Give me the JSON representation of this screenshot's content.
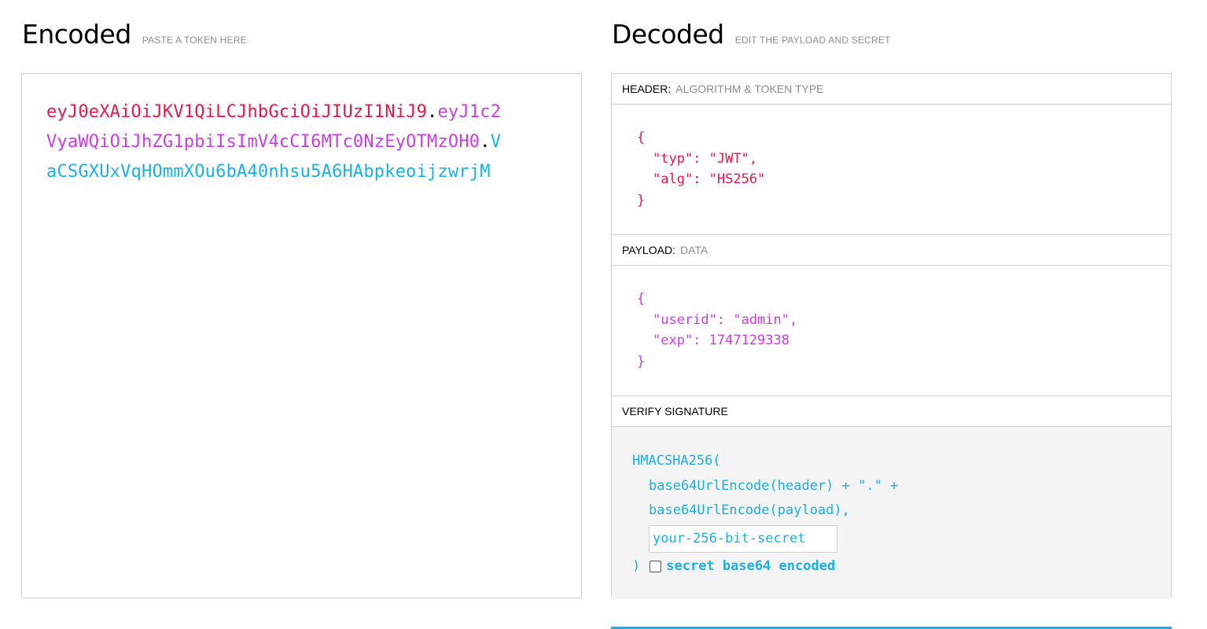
{
  "encoded": {
    "title": "Encoded",
    "hint": "PASTE A TOKEN HERE",
    "token_header": "eyJ0eXAiOiJKV1QiLCJhbGciOiJIUzI1NiJ9",
    "token_payload": "eyJ1c2VyaWQiOiJhZG1pbiIsImV4cCI6MTc0NzEyOTMzOH0",
    "token_signature": "VaCSGXUxVqHOmmXOu6bA40nhsu5A6HAbpkeoijzwrjM",
    "dot": "."
  },
  "decoded": {
    "title": "Decoded",
    "hint": "EDIT THE PAYLOAD AND SECRET",
    "header": {
      "label": "HEADER:",
      "sublabel": "ALGORITHM & TOKEN TYPE",
      "open": "{",
      "line1": "\"typ\": \"JWT\",",
      "line2": "\"alg\": \"HS256\"",
      "close": "}"
    },
    "payload": {
      "label": "PAYLOAD:",
      "sublabel": "DATA",
      "open": "{",
      "line1": "\"userid\": \"admin\",",
      "line2": "\"exp\": 1747129338",
      "close": "}"
    },
    "signature": {
      "label": "VERIFY SIGNATURE",
      "fn_open": "HMACSHA256(",
      "line1": "base64UrlEncode(header) + \".\" +",
      "line2": "base64UrlEncode(payload),",
      "secret_placeholder": "your-256-bit-secret",
      "fn_close": ")",
      "checkbox_label": "secret base64 encoded",
      "checkbox_checked": false
    }
  },
  "colors": {
    "header": "#e8184a",
    "payload": "#c93ee0",
    "signature": "#1ab0e6"
  }
}
